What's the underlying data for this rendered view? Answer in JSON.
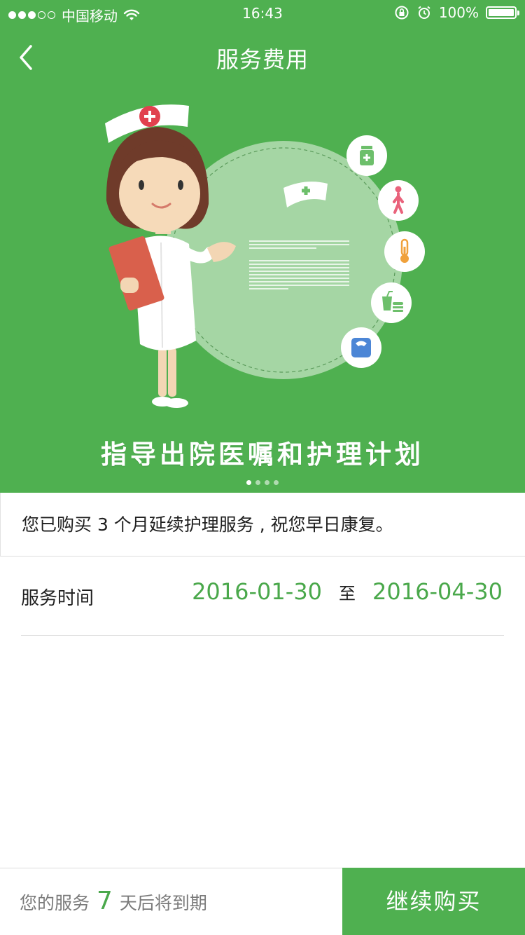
{
  "status_bar": {
    "carrier": "中国移动",
    "time": "16:43",
    "battery": "100%"
  },
  "nav": {
    "title": "服务费用"
  },
  "banner": {
    "caption": "指导出院医嘱和护理计划",
    "page_count": 4,
    "active_page": 1
  },
  "purchase": {
    "message": "您已购买 3 个月延续护理服务 , 祝您早日康复。"
  },
  "service_time": {
    "label": "服务时间",
    "start": "2016-01-30",
    "separator": "至",
    "end": "2016-04-30"
  },
  "footer": {
    "expire_prefix": "您的服务",
    "days": "7",
    "expire_suffix": "天后将到期",
    "buy_label": "继续购买"
  },
  "colors": {
    "brand_green": "#4fb050",
    "accent_text_green": "#4aa84b"
  }
}
